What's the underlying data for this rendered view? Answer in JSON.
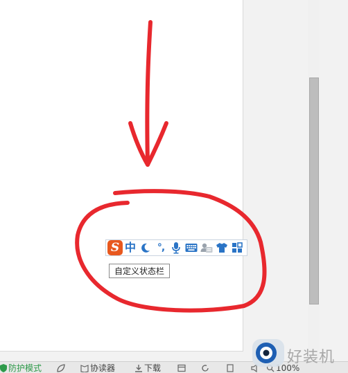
{
  "ime_toolbar": {
    "logo": "S",
    "mode_label": "中",
    "punctuation_label": "°,",
    "icons": [
      "sogou-logo-icon",
      "chinese-mode",
      "moon-icon",
      "punctuation-mode",
      "microphone-icon",
      "keyboard-icon",
      "user-card-icon",
      "shirt-icon",
      "toolbox-icon"
    ]
  },
  "tooltip": {
    "text": "自定义状态栏"
  },
  "status_bar": {
    "items": [
      "防护模式",
      "协读器",
      "下载",
      "100%"
    ]
  },
  "watermark": {
    "text": "好装机"
  },
  "colors": {
    "annotation_red": "#e8282e",
    "ime_blue": "#2a74c6",
    "logo_orange": "#e8581e",
    "status_green": "#2e9a4a"
  }
}
